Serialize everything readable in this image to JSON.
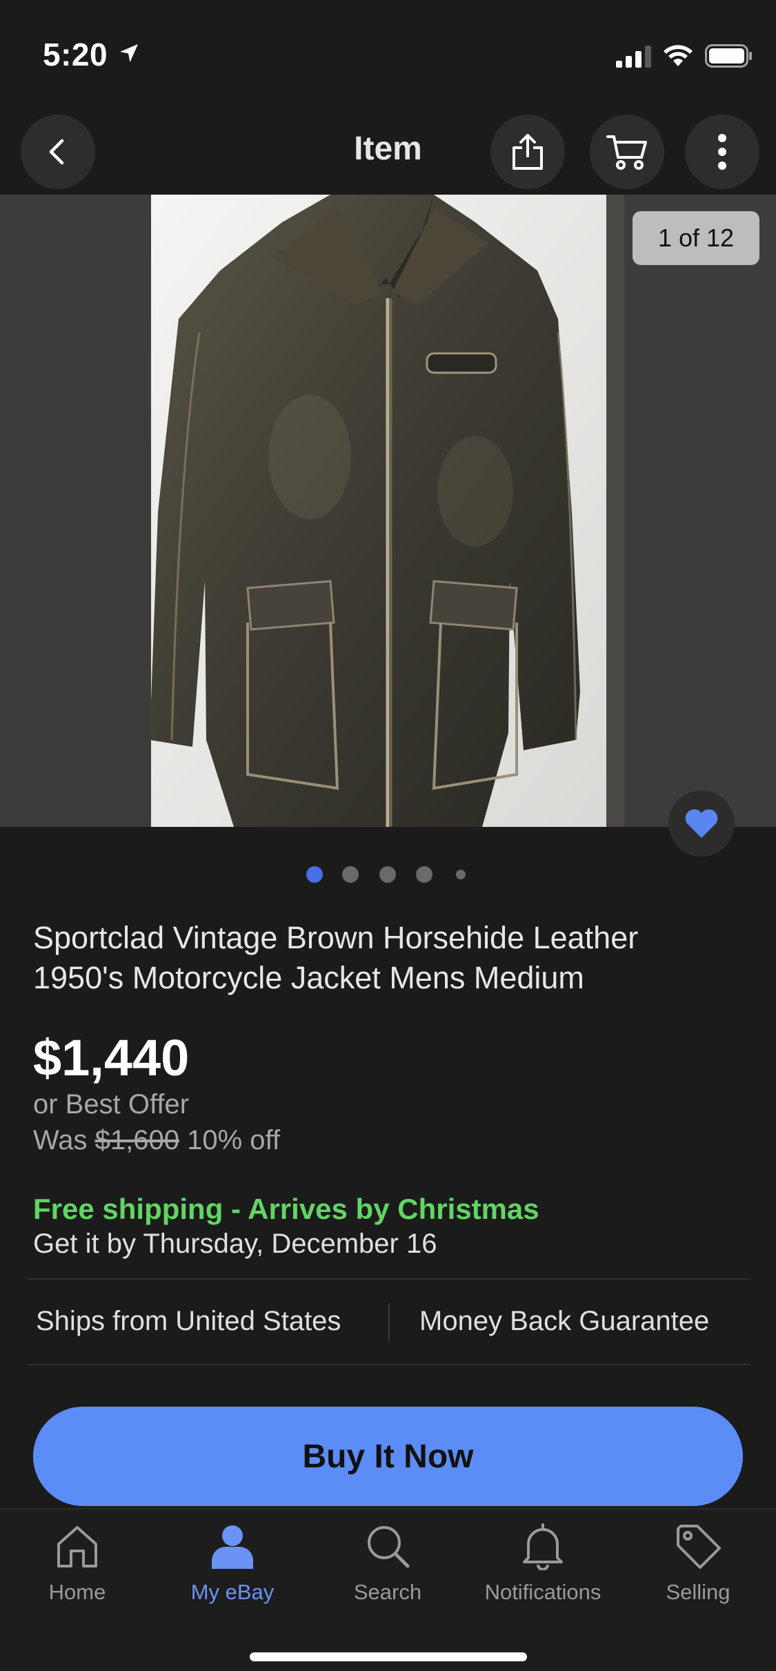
{
  "status_bar": {
    "time": "5:20",
    "icons": [
      "location-arrow-icon",
      "cellular-signal-icon",
      "wifi-icon",
      "battery-icon"
    ]
  },
  "nav": {
    "title": "Item",
    "icons": [
      "chevron-left-icon",
      "share-icon",
      "cart-icon",
      "more-vertical-icon"
    ]
  },
  "gallery": {
    "counter": "1 of 12",
    "total_dots": 5,
    "active_dot": 1,
    "favorite_icon": "heart-icon",
    "favorite_color": "#5b86f2"
  },
  "listing": {
    "title": "Sportclad Vintage Brown Horsehide Leather 1950's Motorcycle Jacket Mens Medium",
    "price": "$1,440",
    "best_offer": "or Best Offer",
    "was_label": "Was",
    "was_price": "$1,600",
    "discount": "10% off"
  },
  "shipping": {
    "headline": "Free shipping - Arrives by Christmas",
    "headline_color": "#62d563",
    "delivery": "Get it by Thursday, December 16"
  },
  "trust": {
    "origin": "Ships from United States",
    "guarantee": "Money Back Guarantee"
  },
  "buy_button": {
    "label": "Buy It Now",
    "color": "#5c8df6"
  },
  "tabs": [
    {
      "label": "Home",
      "icon": "home-icon",
      "active": false
    },
    {
      "label": "My eBay",
      "icon": "person-icon",
      "active": true
    },
    {
      "label": "Search",
      "icon": "search-icon",
      "active": false
    },
    {
      "label": "Notifications",
      "icon": "bell-icon",
      "active": false
    },
    {
      "label": "Selling",
      "icon": "tag-icon",
      "active": false
    }
  ],
  "accent_color": "#6b93f5"
}
